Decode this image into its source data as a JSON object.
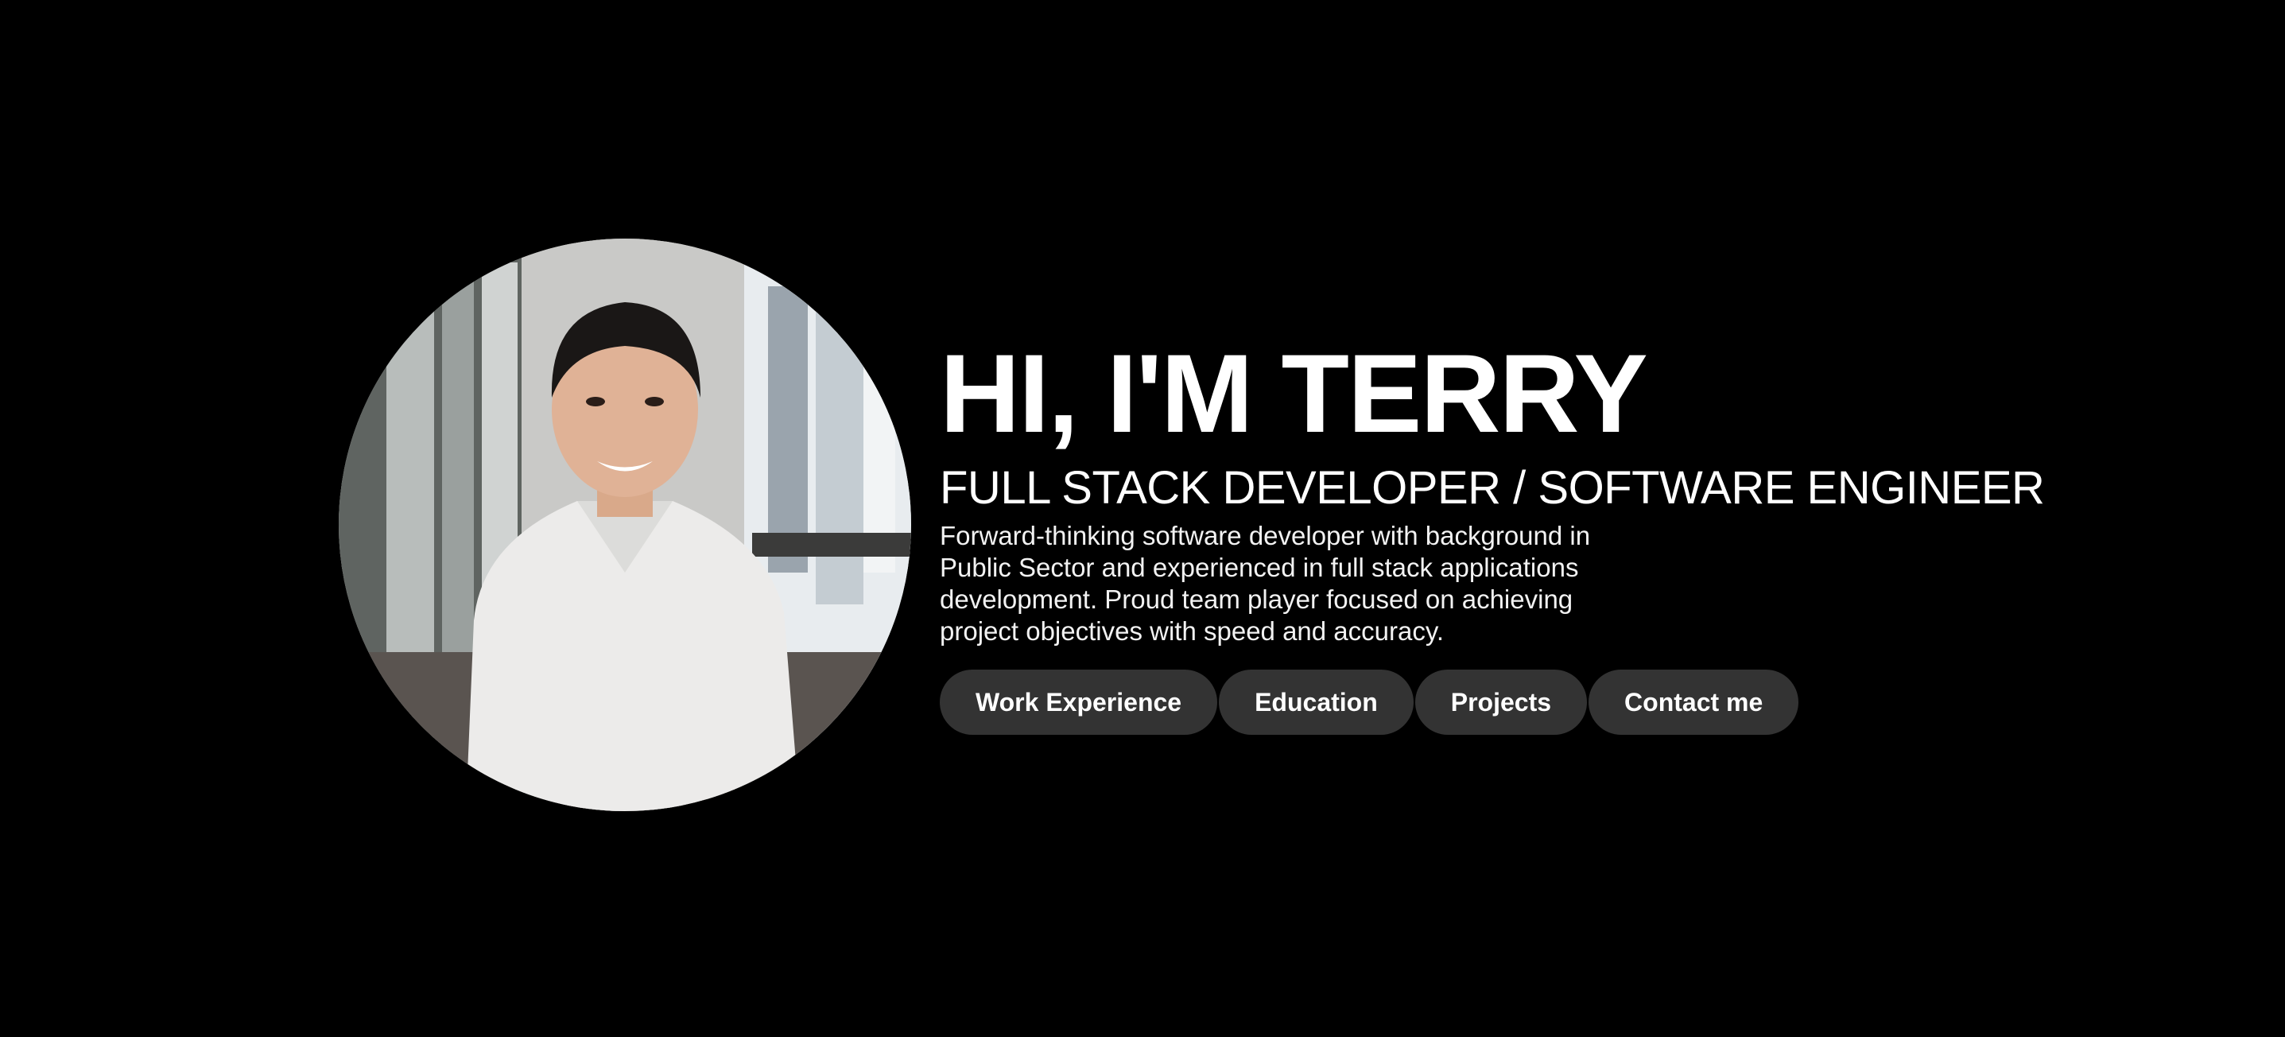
{
  "profile": {
    "photo_alt": "Portrait photo",
    "greeting": "HI, I'M TERRY",
    "role": "FULL STACK DEVELOPER / SOFTWARE ENGINEER",
    "bio": "Forward-thinking software developer with background in Public Sector and experienced in full stack applications development. Proud team player focused on achieving project objectives with speed and accuracy."
  },
  "nav": {
    "buttons": [
      {
        "label": "Work Experience"
      },
      {
        "label": "Education"
      },
      {
        "label": "Projects"
      },
      {
        "label": "Contact me"
      }
    ]
  },
  "colors": {
    "background": "#000000",
    "text": "#ffffff",
    "button_bg": "#333333"
  }
}
